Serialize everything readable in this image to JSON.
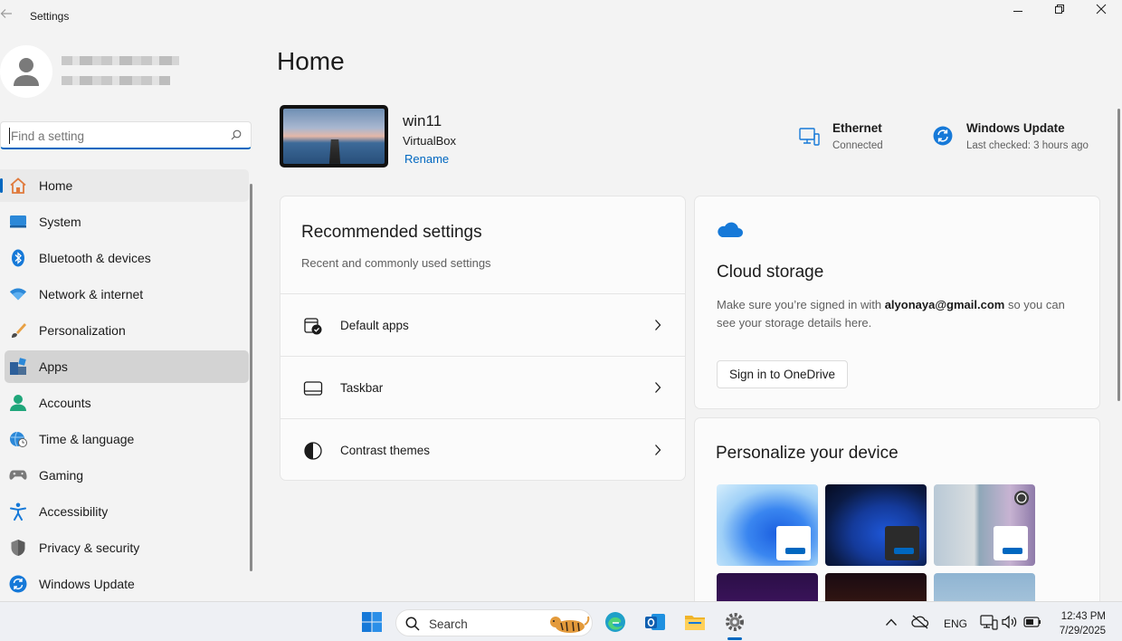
{
  "window": {
    "title": "Settings"
  },
  "sidebar": {
    "search_placeholder": "Find a setting",
    "items": [
      {
        "label": "Home",
        "icon": "home-icon"
      },
      {
        "label": "System",
        "icon": "system-icon"
      },
      {
        "label": "Bluetooth & devices",
        "icon": "bluetooth-icon"
      },
      {
        "label": "Network & internet",
        "icon": "network-icon"
      },
      {
        "label": "Personalization",
        "icon": "brush-icon"
      },
      {
        "label": "Apps",
        "icon": "apps-icon"
      },
      {
        "label": "Accounts",
        "icon": "accounts-icon"
      },
      {
        "label": "Time & language",
        "icon": "time-language-icon"
      },
      {
        "label": "Gaming",
        "icon": "gamepad-icon"
      },
      {
        "label": "Accessibility",
        "icon": "accessibility-icon"
      },
      {
        "label": "Privacy & security",
        "icon": "shield-icon"
      },
      {
        "label": "Windows Update",
        "icon": "update-icon"
      }
    ]
  },
  "main": {
    "title": "Home",
    "device": {
      "name": "win11",
      "model": "VirtualBox",
      "rename_label": "Rename"
    },
    "status": [
      {
        "title": "Ethernet",
        "subtitle": "Connected",
        "icon": "ethernet-icon"
      },
      {
        "title": "Windows Update",
        "subtitle": "Last checked: 3 hours ago",
        "icon": "update-icon"
      }
    ],
    "recommended": {
      "title": "Recommended settings",
      "subtitle": "Recent and commonly used settings",
      "rows": [
        {
          "label": "Default apps",
          "icon": "default-apps-icon"
        },
        {
          "label": "Taskbar",
          "icon": "taskbar-icon"
        },
        {
          "label": "Contrast themes",
          "icon": "contrast-icon"
        }
      ]
    },
    "cloud": {
      "title": "Cloud storage",
      "desc_before": "Make sure you’re signed in with ",
      "email": "alyonaya@gmail.com",
      "desc_after": " so you can see your storage details here.",
      "button": "Sign in to OneDrive"
    },
    "personalize": {
      "title": "Personalize your device"
    }
  },
  "taskbar": {
    "search_label": "Search",
    "language": "ENG",
    "time": "12:43 PM",
    "date": "7/29/2025"
  },
  "colors": {
    "accent": "#0067c0",
    "background": "#f3f3f3",
    "card": "#fbfbfb"
  }
}
